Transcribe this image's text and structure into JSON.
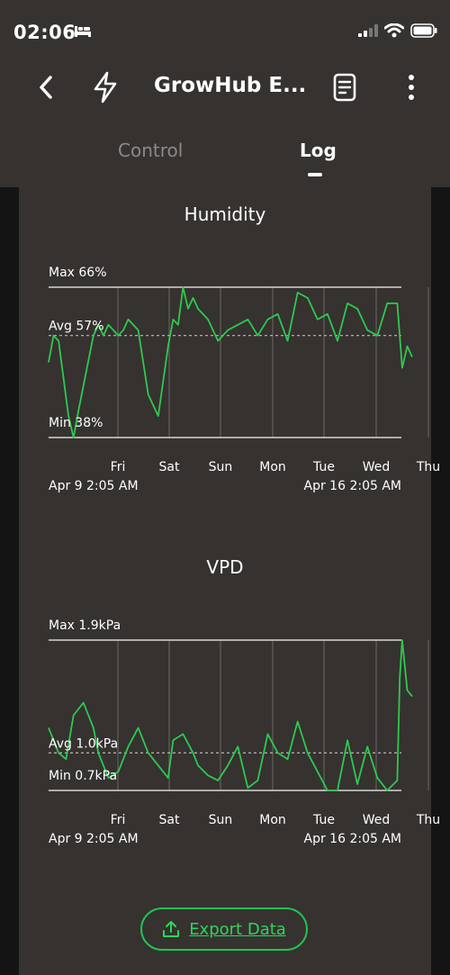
{
  "status_bar": {
    "time": "02:06"
  },
  "nav": {
    "title": "GrowHub E..."
  },
  "tabs": [
    {
      "label": "Control",
      "active": false
    },
    {
      "label": "Log",
      "active": true
    }
  ],
  "charts_meta": {
    "humidity": {
      "title": "Humidity",
      "max_label": "Max 66%",
      "avg_label": "Avg 57%",
      "min_label": "Min 38%",
      "days": [
        "Fri",
        "Sat",
        "Sun",
        "Mon",
        "Tue",
        "Wed",
        "Thu"
      ],
      "start_label": "Apr 9 2:05 AM",
      "end_label": "Apr 16 2:05 AM"
    },
    "vpd": {
      "title": "VPD",
      "max_label": "Max 1.9kPa",
      "avg_label": "Avg 1.0kPa",
      "min_label": "Min 0.7kPa",
      "days": [
        "Fri",
        "Sat",
        "Sun",
        "Mon",
        "Tue",
        "Wed",
        "Thu"
      ],
      "start_label": "Apr 9 2:05 AM",
      "end_label": "Apr 16 2:05 AM"
    }
  },
  "chart_data": [
    {
      "type": "line",
      "title": "Humidity",
      "x_unit": "days since Apr 9 2:05 AM",
      "ylim": [
        38,
        66
      ],
      "avg": 57,
      "series": [
        {
          "name": "Humidity",
          "x": [
            0,
            0.1,
            0.2,
            0.3,
            0.4,
            0.5,
            0.6,
            0.75,
            0.9,
            1.0,
            1.1,
            1.2,
            1.4,
            1.5,
            1.6,
            1.8,
            2.0,
            2.2,
            2.4,
            2.5,
            2.6,
            2.7,
            2.8,
            2.9,
            3.0,
            3.2,
            3.4,
            3.6,
            3.8,
            4.0,
            4.2,
            4.4,
            4.6,
            4.8,
            5.0,
            5.2,
            5.4,
            5.6,
            5.8,
            6.0,
            6.2,
            6.4,
            6.6,
            6.8,
            7.0,
            7.1,
            7.2,
            7.3
          ],
          "values": [
            52,
            57,
            56,
            49,
            42,
            38,
            43,
            50,
            57,
            59,
            57,
            59,
            57,
            58,
            60,
            58,
            46,
            42,
            55,
            60,
            59,
            66,
            62,
            64,
            62,
            60,
            56,
            58,
            59,
            60,
            57,
            60,
            61,
            56,
            65,
            64,
            60,
            61,
            56,
            63,
            62,
            58,
            57,
            63,
            63,
            51,
            55,
            53
          ]
        }
      ]
    },
    {
      "type": "line",
      "title": "VPD",
      "x_unit": "days since Apr 9 2:05 AM",
      "ylim": [
        0.7,
        1.9
      ],
      "avg": 1.0,
      "series": [
        {
          "name": "VPD",
          "x": [
            0,
            0.2,
            0.35,
            0.5,
            0.7,
            0.9,
            1.0,
            1.2,
            1.4,
            1.6,
            1.8,
            2.0,
            2.2,
            2.4,
            2.5,
            2.7,
            2.9,
            3.0,
            3.2,
            3.4,
            3.6,
            3.8,
            4.0,
            4.2,
            4.4,
            4.6,
            4.8,
            5.0,
            5.2,
            5.4,
            5.6,
            5.8,
            6.0,
            6.2,
            6.4,
            6.6,
            6.8,
            7.0,
            7.05,
            7.1,
            7.2,
            7.3
          ],
          "values": [
            1.2,
            1.0,
            0.95,
            1.3,
            1.4,
            1.2,
            1.0,
            0.8,
            0.85,
            1.05,
            1.2,
            1.0,
            0.9,
            0.8,
            1.1,
            1.15,
            1.0,
            0.9,
            0.82,
            0.78,
            0.9,
            1.05,
            0.72,
            0.78,
            1.15,
            1.0,
            0.95,
            1.25,
            1.0,
            0.85,
            0.7,
            0.7,
            1.1,
            0.75,
            1.05,
            0.8,
            0.7,
            0.78,
            1.6,
            1.9,
            1.5,
            1.45
          ]
        }
      ]
    }
  ],
  "export": {
    "label": "Export Data"
  },
  "colors": {
    "accent": "#2dd65a",
    "panel": "#353230",
    "background": "#141414"
  }
}
